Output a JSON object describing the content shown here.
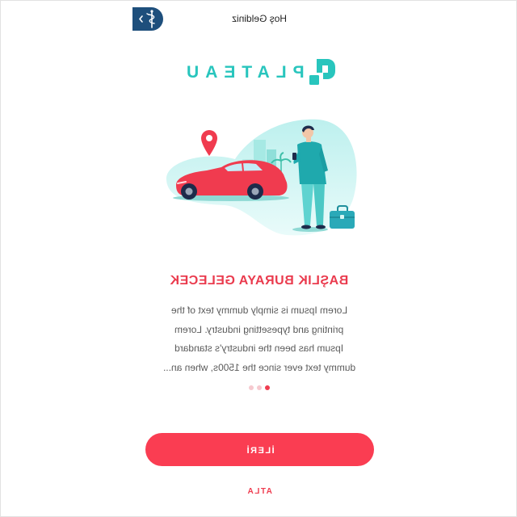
{
  "header": {
    "title": "Hoş Geldiniz",
    "back_icon": "chevron-left-icon",
    "brand_icon": "caduceus-icon"
  },
  "logo": {
    "text": "PLATEAU",
    "icon": "plateau-logo-icon"
  },
  "illustration": {
    "subject": "car-and-person-illustration",
    "icons": [
      "map-pin-icon",
      "car-icon",
      "person-icon",
      "briefcase-icon",
      "city-buildings-icon"
    ]
  },
  "onboarding": {
    "heading": "BAŞLIK BURAYA GELECEK",
    "body_lines": [
      "Lorem Ipsum is simply dummy text of the",
      "printing and typesetting industry. Lorem",
      "Ipsum has been the industry's standard",
      "dummy text ever since the 1500s, when an..."
    ],
    "page_count": 3,
    "active_page": 1
  },
  "actions": {
    "next_label": "İLERİ",
    "skip_label": "ATLA"
  },
  "colors": {
    "primary_red": "#fa3d52",
    "heading_red": "#ea3b4e",
    "brand_teal": "#28c5bd",
    "header_button_navy": "#1e4f7c",
    "body_text_gray": "#5a5a5a"
  }
}
